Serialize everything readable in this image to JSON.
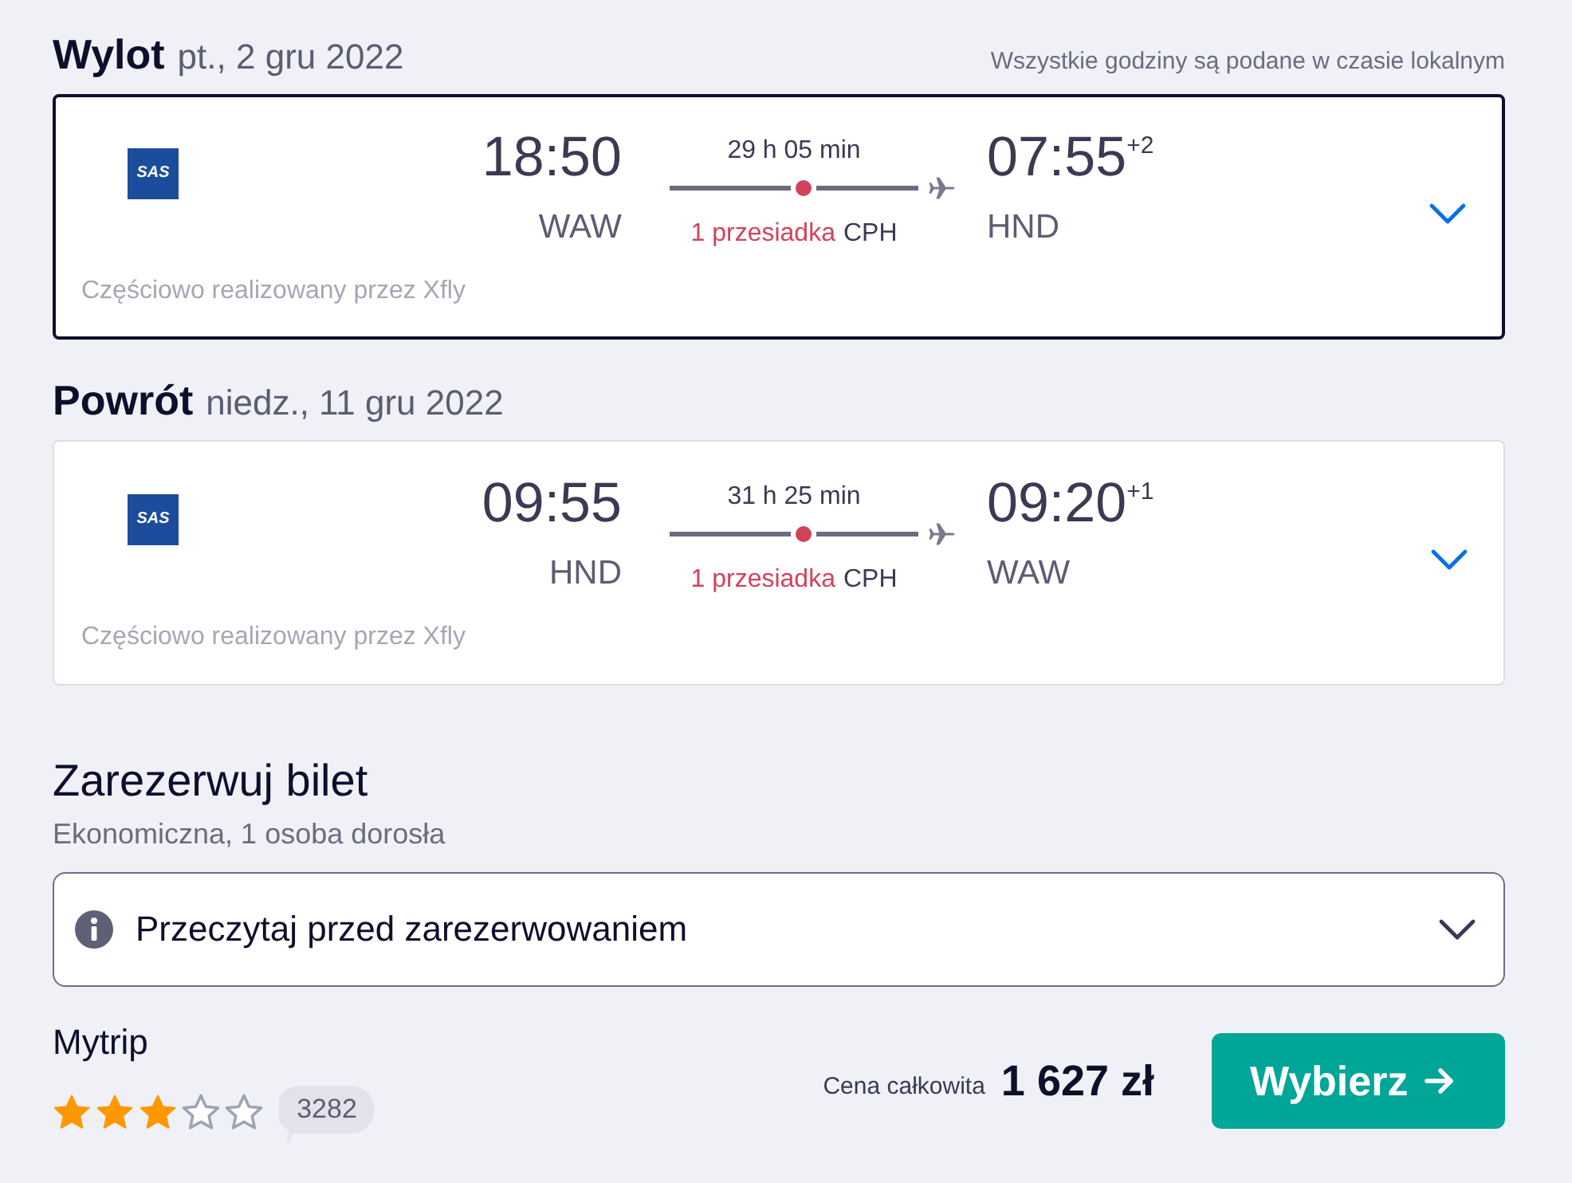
{
  "timezone_note": "Wszystkie godziny są podane w czasie lokalnym",
  "legs": [
    {
      "title": "Wylot",
      "date": "pt., 2 gru 2022",
      "selected": true,
      "expanded": false,
      "airline": "SAS",
      "departure_time": "18:50",
      "departure_airport": "WAW",
      "duration": "29 h 05 min",
      "stops": "1 przesiadka",
      "stop_airport": "CPH",
      "arrival_time": "07:55",
      "day_offset": "+2",
      "arrival_airport": "HND",
      "operated_by": "Częściowo realizowany przez Xfly"
    },
    {
      "title": "Powrót",
      "date": "niedz., 11 gru 2022",
      "selected": false,
      "expanded": false,
      "airline": "SAS",
      "departure_time": "09:55",
      "departure_airport": "HND",
      "duration": "31 h 25 min",
      "stops": "1 przesiadka",
      "stop_airport": "CPH",
      "arrival_time": "09:20",
      "day_offset": "+1",
      "arrival_airport": "WAW",
      "operated_by": "Częściowo realizowany przez Xfly"
    }
  ],
  "booking": {
    "title": "Zarezerwuj bilet",
    "subtitle": "Ekonomiczna, 1 osoba dorosła",
    "notice": {
      "label": "Przeczytaj przed zarezerwowaniem",
      "expanded": false
    },
    "provider": {
      "name": "Mytrip",
      "stars": 3,
      "reviews": "3282"
    },
    "price_label": "Cena całkowita",
    "price": "1 627 zł",
    "button": "Wybierz"
  }
}
